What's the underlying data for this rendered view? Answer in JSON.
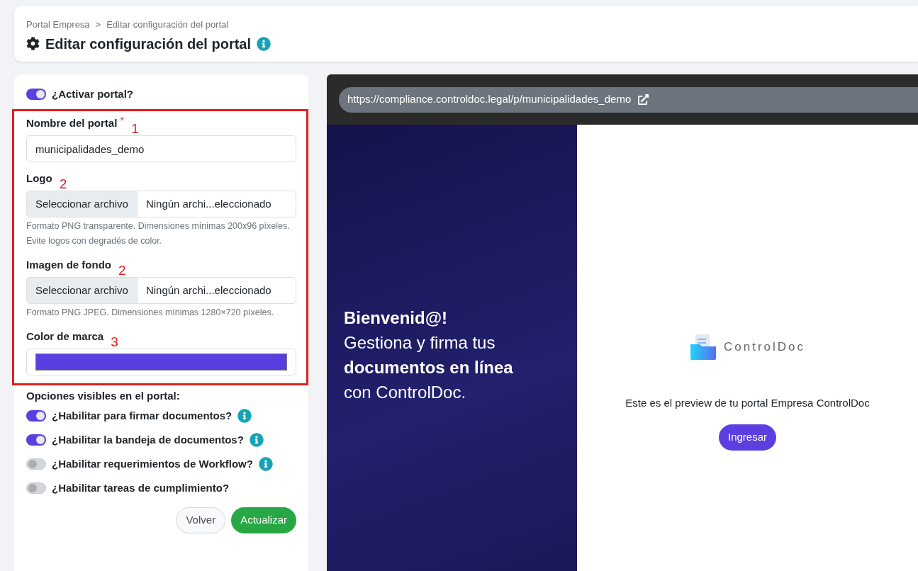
{
  "breadcrumb": [
    "Portal Empresa",
    "Editar configuración del portal"
  ],
  "breadcrumb_separator": ">",
  "page_title": "Editar configuración del portal",
  "required_mark": "*",
  "activate": {
    "label": "¿Activar portal?",
    "on": true
  },
  "fields": [
    {
      "kind": "text",
      "label": "Nombre del portal",
      "required": true,
      "annotation": "1",
      "value": "municipalidades_demo"
    },
    {
      "kind": "file",
      "label": "Logo",
      "required": false,
      "annotation": "2",
      "button": "Seleccionar archivo",
      "value": "Ningún archi...eleccionado",
      "help": "Formato PNG transparente. Dimensiones mínimas 200x96 píxeles. Evite logos con degradés de color."
    },
    {
      "kind": "file",
      "label": "Imagen de fondo",
      "required": false,
      "annotation": "2",
      "button": "Seleccionar archivo",
      "value": "Ningún archi...eleccionado",
      "help": "Formato PNG JPEG. Dimensiones mínimas 1280×720 píxeles."
    },
    {
      "kind": "color",
      "label": "Color de marca",
      "required": false,
      "annotation": "3",
      "color": "#5a3fe0"
    }
  ],
  "options_title": "Opciones visibles en el portal:",
  "options": [
    {
      "label": "¿Habilitar para firmar documentos?",
      "on": true,
      "info": true
    },
    {
      "label": "¿Habilitar la bandeja de documentos?",
      "on": true,
      "info": true
    },
    {
      "label": "¿Habilitar requerimientos de Workflow?",
      "on": false,
      "info": true
    },
    {
      "label": "¿Habilitar tareas de cumplimiento?",
      "on": false,
      "info": false
    }
  ],
  "buttons": [
    {
      "label": "Volver",
      "kind": "secondary"
    },
    {
      "label": "Actualizar",
      "kind": "primary"
    }
  ],
  "preview": {
    "url": "https://compliance.controldoc.legal/p/municipalidades_demo",
    "welcome": [
      {
        "text": "Bienvenid@!",
        "bold": true
      },
      {
        "text": "Gestiona y firma tus",
        "bold": false
      },
      {
        "text": "documentos en línea",
        "bold": true
      },
      {
        "text": "con ControlDoc.",
        "bold": false
      }
    ],
    "logo_text": "ControlDoc",
    "message": "Este es el preview de tu portal Empresa ControlDoc",
    "login_button": "Ingresar"
  }
}
